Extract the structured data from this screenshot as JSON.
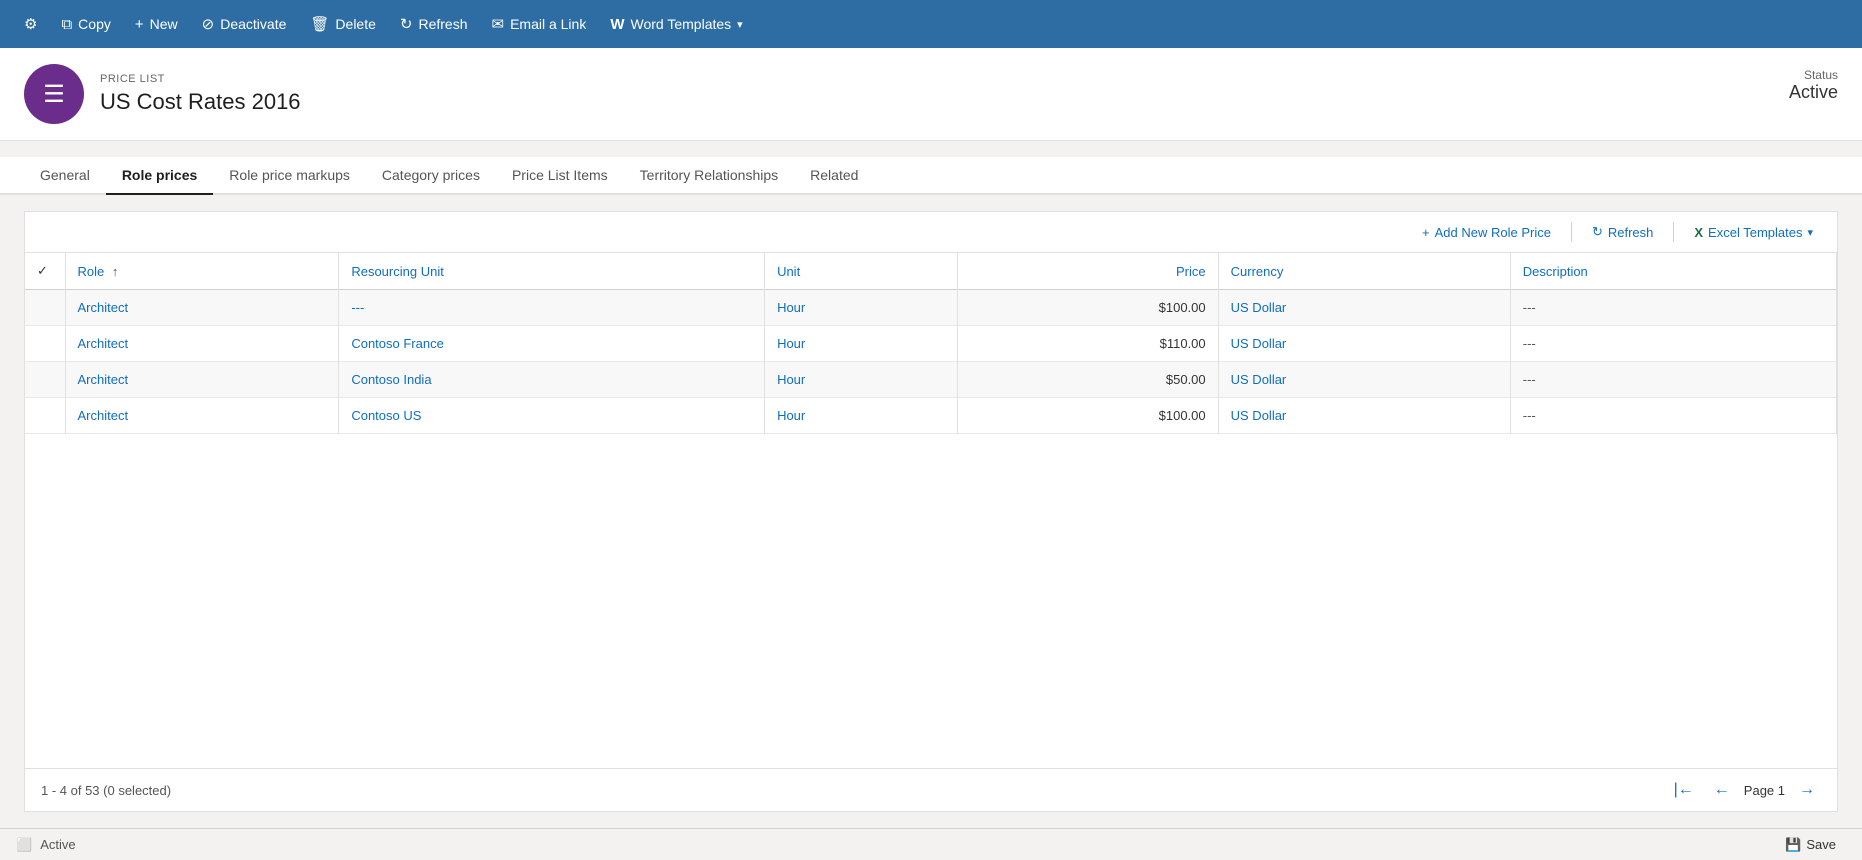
{
  "toolbar": {
    "buttons": [
      {
        "id": "settings",
        "label": "",
        "icon": "⚙"
      },
      {
        "id": "copy",
        "label": "Copy",
        "icon": "⧉"
      },
      {
        "id": "new",
        "label": "New",
        "icon": "+"
      },
      {
        "id": "deactivate",
        "label": "Deactivate",
        "icon": "⊘"
      },
      {
        "id": "delete",
        "label": "Delete",
        "icon": "🗑"
      },
      {
        "id": "refresh",
        "label": "Refresh",
        "icon": "↻"
      },
      {
        "id": "email",
        "label": "Email a Link",
        "icon": "✉"
      },
      {
        "id": "word",
        "label": "Word Templates",
        "icon": "W",
        "dropdown": true
      }
    ]
  },
  "record": {
    "type": "PRICE LIST",
    "name": "US Cost Rates 2016",
    "status_label": "Status",
    "status_value": "Active",
    "avatar_icon": "☰"
  },
  "tabs": {
    "items": [
      {
        "id": "general",
        "label": "General",
        "active": false
      },
      {
        "id": "role-prices",
        "label": "Role prices",
        "active": true
      },
      {
        "id": "role-price-markups",
        "label": "Role price markups",
        "active": false
      },
      {
        "id": "category-prices",
        "label": "Category prices",
        "active": false
      },
      {
        "id": "price-list-items",
        "label": "Price List Items",
        "active": false
      },
      {
        "id": "territory-relationships",
        "label": "Territory Relationships",
        "active": false
      },
      {
        "id": "related",
        "label": "Related",
        "active": false
      }
    ]
  },
  "grid": {
    "toolbar": {
      "add_label": "Add New Role Price",
      "refresh_label": "Refresh",
      "excel_label": "Excel Templates"
    },
    "columns": [
      {
        "id": "check",
        "label": ""
      },
      {
        "id": "role",
        "label": "Role",
        "sortable": true
      },
      {
        "id": "resourcing-unit",
        "label": "Resourcing Unit"
      },
      {
        "id": "unit",
        "label": "Unit"
      },
      {
        "id": "price",
        "label": "Price"
      },
      {
        "id": "currency",
        "label": "Currency"
      },
      {
        "id": "description",
        "label": "Description"
      }
    ],
    "rows": [
      {
        "role": "Architect",
        "resourcing_unit": "---",
        "unit": "Hour",
        "price": "$100.00",
        "currency": "US Dollar",
        "description": "---"
      },
      {
        "role": "Architect",
        "resourcing_unit": "Contoso France",
        "unit": "Hour",
        "price": "$110.00",
        "currency": "US Dollar",
        "description": "---"
      },
      {
        "role": "Architect",
        "resourcing_unit": "Contoso India",
        "unit": "Hour",
        "price": "$50.00",
        "currency": "US Dollar",
        "description": "---"
      },
      {
        "role": "Architect",
        "resourcing_unit": "Contoso US",
        "unit": "Hour",
        "price": "$100.00",
        "currency": "US Dollar",
        "description": "---"
      }
    ],
    "footer": {
      "count_text": "1 - 4 of 53 (0 selected)",
      "page_label": "Page 1"
    }
  },
  "status_bar": {
    "status": "Active",
    "save_label": "Save"
  }
}
